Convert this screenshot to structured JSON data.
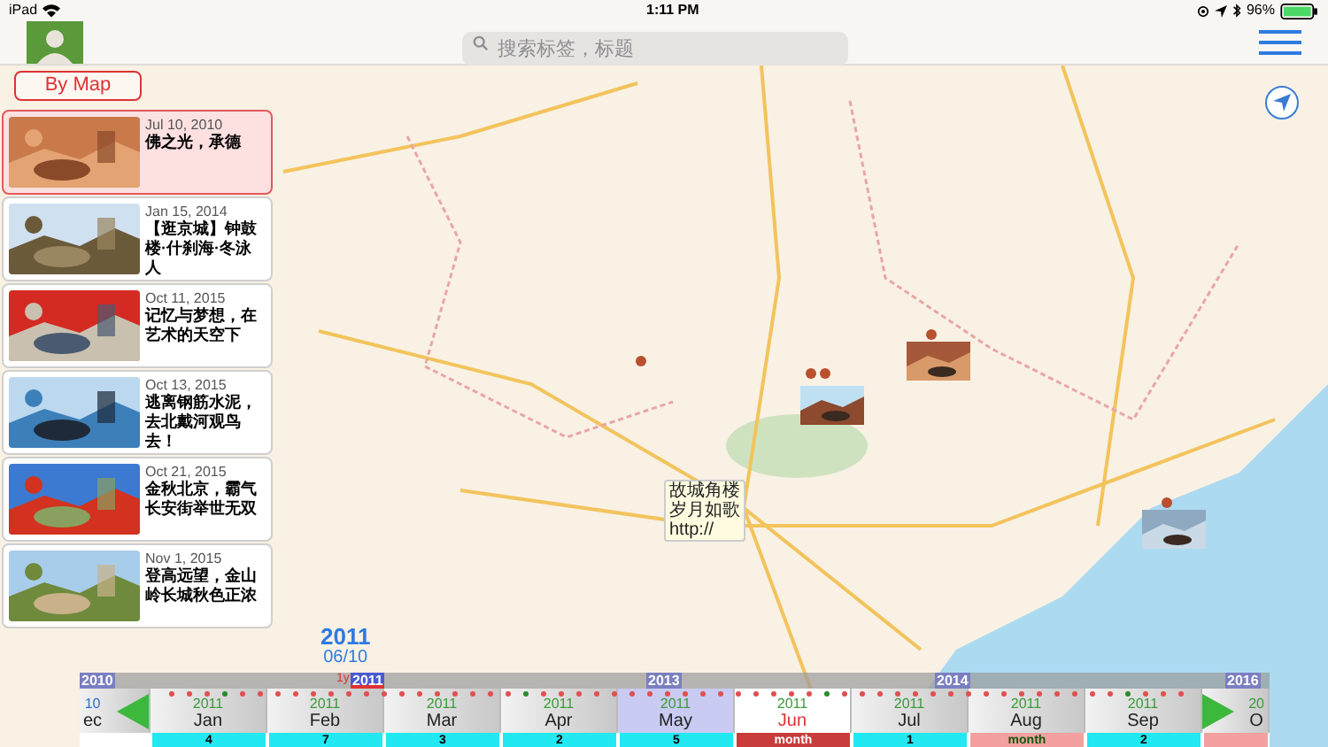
{
  "status_bar": {
    "device": "iPad",
    "time": "1:11 PM",
    "battery": "96%"
  },
  "search": {
    "placeholder": "搜索标签，标题"
  },
  "by_map_button": "By Map",
  "cards": [
    {
      "date": "Jul 10, 2010",
      "title": "佛之光，承德",
      "selected": true
    },
    {
      "date": "Jan 15, 2014",
      "title": "【逛京城】钟鼓楼·什刹海·冬泳人",
      "selected": false
    },
    {
      "date": "Oct 11, 2015",
      "title": "记忆与梦想，在艺术的天空下",
      "selected": false
    },
    {
      "date": "Oct 13, 2015",
      "title": "逃离钢筋水泥，去北戴河观鸟去！",
      "selected": false
    },
    {
      "date": "Oct 21, 2015",
      "title": "金秋北京，霸气长安街举世无双",
      "selected": false
    },
    {
      "date": "Nov 1, 2015",
      "title": "登高远望，金山岭长城秋色正浓",
      "selected": false
    }
  ],
  "callout": {
    "lines": [
      "故城角楼",
      "岁月如歌",
      "http://"
    ]
  },
  "current_date": {
    "year": "2011",
    "day": "06/10",
    "scale": "1y"
  },
  "timeline": {
    "years": [
      {
        "label": "2010",
        "selected": false
      },
      {
        "label": "2011",
        "selected": true
      },
      {
        "label": "2013",
        "selected": false
      },
      {
        "label": "2014",
        "selected": false
      },
      {
        "label": "2016",
        "selected": false
      }
    ],
    "months": [
      {
        "year": "10",
        "month": "ec",
        "selected": false,
        "highlighted": false
      },
      {
        "year": "2011",
        "month": "Jan",
        "selected": false,
        "highlighted": false,
        "count": {
          "kind": "number",
          "text": "4"
        }
      },
      {
        "year": "2011",
        "month": "Feb",
        "selected": false,
        "highlighted": false,
        "count": {
          "kind": "number",
          "text": "7"
        }
      },
      {
        "year": "2011",
        "month": "Mar",
        "selected": false,
        "highlighted": false,
        "count": {
          "kind": "number",
          "text": "3"
        }
      },
      {
        "year": "2011",
        "month": "Apr",
        "selected": false,
        "highlighted": false,
        "count": {
          "kind": "number",
          "text": "2"
        }
      },
      {
        "year": "2011",
        "month": "May",
        "selected": false,
        "highlighted": true,
        "count": {
          "kind": "number",
          "text": "5"
        }
      },
      {
        "year": "2011",
        "month": "Jun",
        "selected": true,
        "highlighted": false,
        "count": {
          "kind": "month",
          "text": "month"
        }
      },
      {
        "year": "2011",
        "month": "Jul",
        "selected": false,
        "highlighted": false,
        "count": {
          "kind": "number",
          "text": "1"
        }
      },
      {
        "year": "2011",
        "month": "Aug",
        "selected": false,
        "highlighted": false,
        "count": {
          "kind": "month",
          "text": "month"
        }
      },
      {
        "year": "2011",
        "month": "Sep",
        "selected": false,
        "highlighted": false,
        "count": {
          "kind": "number",
          "text": "2"
        }
      },
      {
        "year": "20",
        "month": "O",
        "selected": false,
        "highlighted": false,
        "count": {
          "kind": "month"
        }
      }
    ]
  }
}
